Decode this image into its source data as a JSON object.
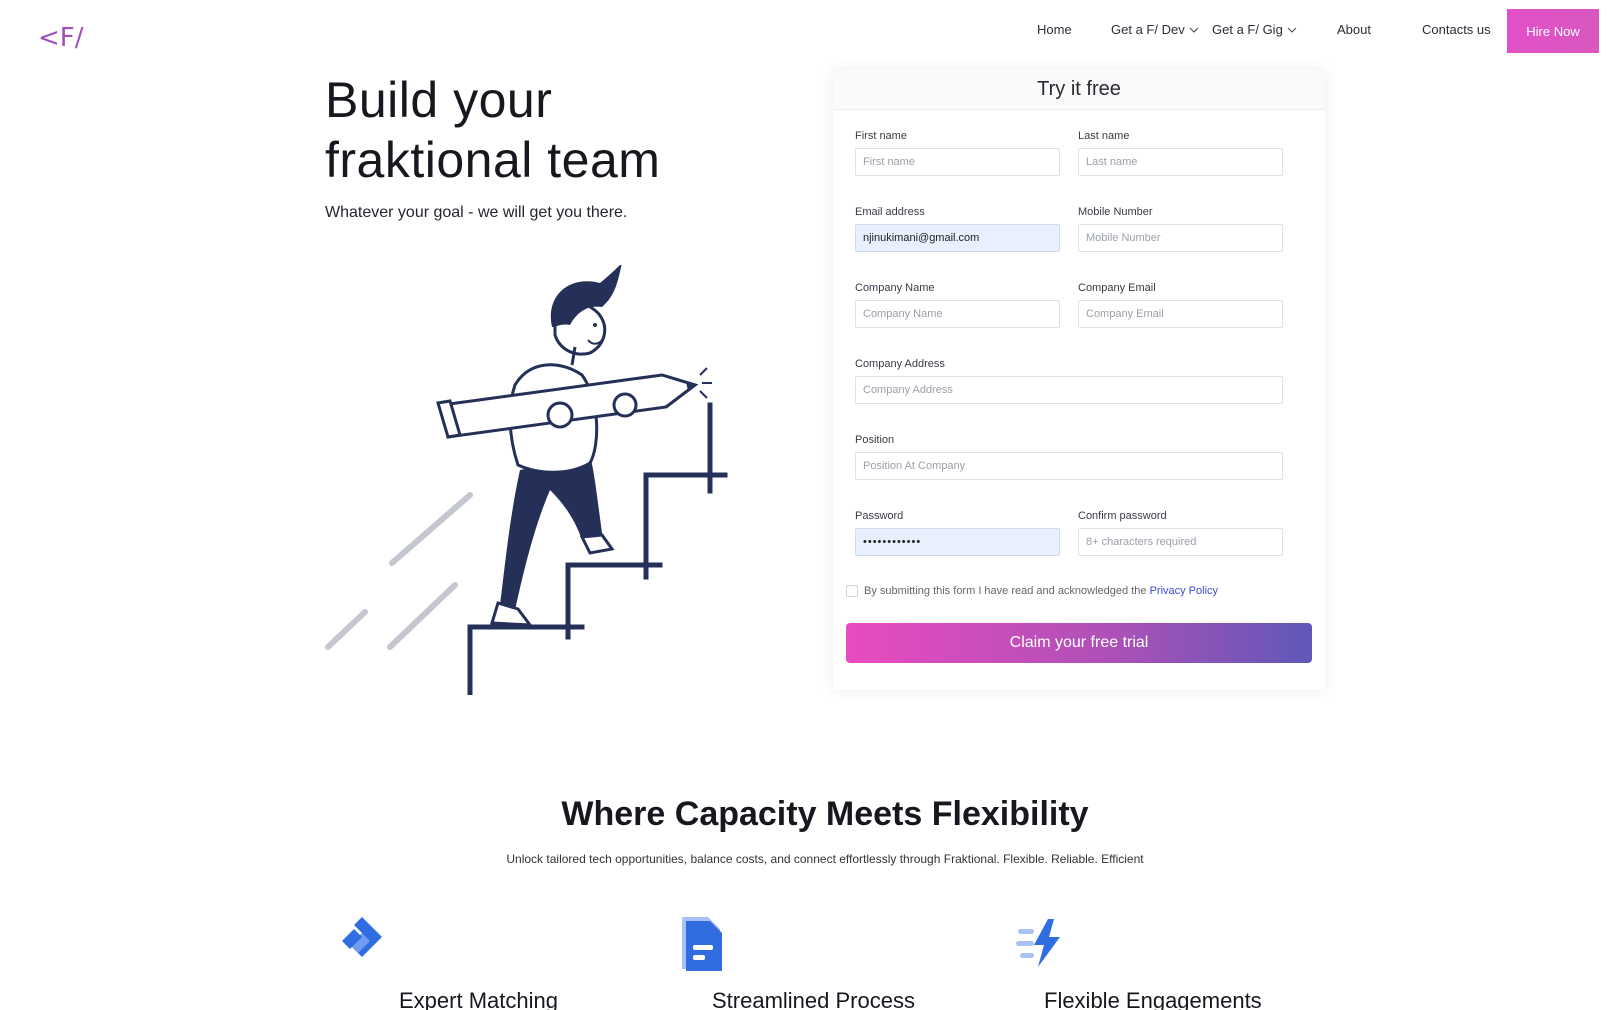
{
  "header": {
    "logo_text": "<F/>",
    "nav": {
      "home": "Home",
      "get_dev": "Get a F/ Dev",
      "get_gig": "Get a F/ Gig",
      "about": "About",
      "contacts": "Contacts us"
    },
    "hire_button": "Hire Now"
  },
  "hero": {
    "title_line1": "Build your",
    "title_line2": "fraktional team",
    "subtitle": "Whatever your goal - we will get you there."
  },
  "form": {
    "title": "Try it free",
    "fields": {
      "first_name": {
        "label": "First name",
        "placeholder": "First name",
        "value": ""
      },
      "last_name": {
        "label": "Last name",
        "placeholder": "Last name",
        "value": ""
      },
      "email": {
        "label": "Email address",
        "placeholder": "",
        "value": "njinukimani@gmail.com"
      },
      "mobile": {
        "label": "Mobile Number",
        "placeholder": "Mobile Number",
        "value": ""
      },
      "company_name": {
        "label": "Company Name",
        "placeholder": "Company Name",
        "value": ""
      },
      "company_email": {
        "label": "Company Email",
        "placeholder": "Company Email",
        "value": ""
      },
      "company_address": {
        "label": "Company Address",
        "placeholder": "Company Address",
        "value": ""
      },
      "position": {
        "label": "Position",
        "placeholder": "Position At Company",
        "value": ""
      },
      "password": {
        "label": "Password",
        "placeholder": "",
        "value": "••••••••••••"
      },
      "confirm_password": {
        "label": "Confirm password",
        "placeholder": "8+ characters required",
        "value": ""
      }
    },
    "consent_text": "By submitting this form I have read and acknowledged the",
    "privacy_link": "Privacy Policy",
    "submit_label": "Claim your free trial"
  },
  "features_section": {
    "title": "Where Capacity Meets Flexibility",
    "subtitle": "Unlock tailored tech opportunities, balance costs, and connect effortlessly through Fraktional. Flexible. Reliable. Efficient",
    "items": [
      {
        "title": "Expert Matching",
        "icon": "diamond-icon"
      },
      {
        "title": "Streamlined Process",
        "icon": "document-icon"
      },
      {
        "title": "Flexible Engagements",
        "icon": "lightning-icon"
      }
    ]
  },
  "colors": {
    "brand_pink": "#e150c8",
    "brand_purple": "#5f58b8",
    "illustration_navy": "#243058",
    "icon_blue": "#2f6de1"
  }
}
